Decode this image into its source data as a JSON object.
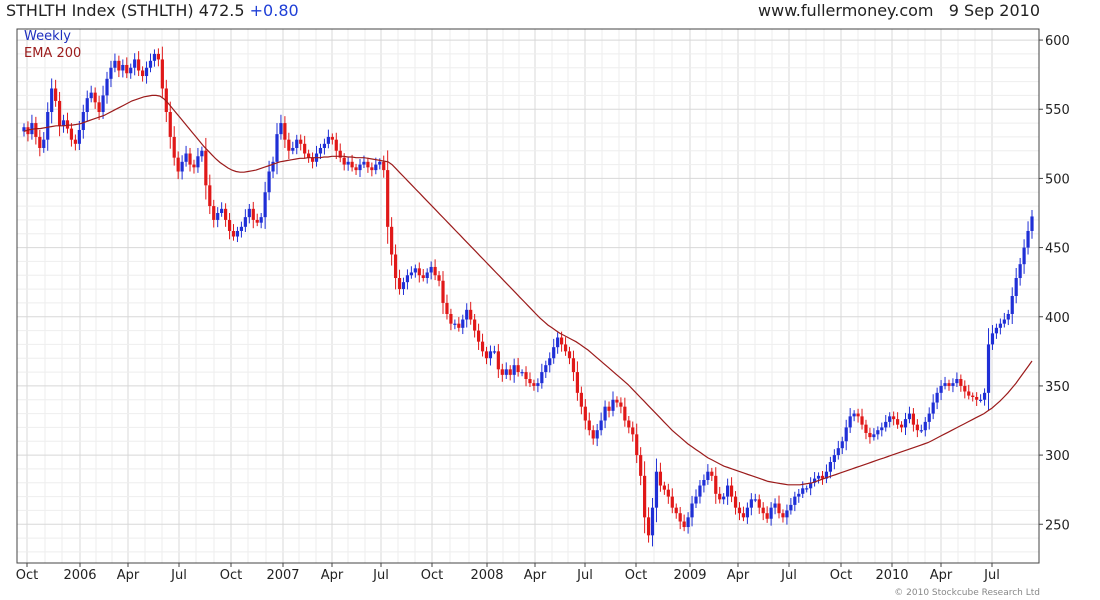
{
  "header": {
    "title": "STHLTH Index (STHLTH) 472.5",
    "change": "+0.80",
    "site": "www.fullermoney.com",
    "date": "9 Sep 2010"
  },
  "legend": {
    "weekly": "Weekly",
    "ema": "EMA 200"
  },
  "copyright": "© 2010 Stockcube Research Ltd",
  "colors": {
    "up": "#1f2fd6",
    "down": "#e01818",
    "ema": "#9b1b1b",
    "grid": "#d8d8d8",
    "frame": "#444444"
  },
  "chart_data": {
    "type": "candlestick",
    "interval": "weekly",
    "x_ticks": [
      "Oct",
      "2006",
      "Apr",
      "Jul",
      "Oct",
      "2007",
      "Apr",
      "Jul",
      "Oct",
      "2008",
      "Apr",
      "Jul",
      "Oct",
      "2009",
      "Apr",
      "Jul",
      "Oct",
      "2010",
      "Apr",
      "Jul"
    ],
    "y_ticks": [
      250,
      300,
      350,
      400,
      450,
      500,
      550,
      600
    ],
    "ylim": [
      222,
      608
    ],
    "y_axis_side": "right",
    "weekly_close": [
      537,
      532,
      540,
      530,
      522,
      528,
      548,
      565,
      556,
      538,
      542,
      536,
      528,
      525,
      535,
      548,
      558,
      562,
      555,
      548,
      560,
      572,
      580,
      585,
      578,
      582,
      576,
      580,
      586,
      578,
      574,
      580,
      585,
      590,
      586,
      565,
      548,
      530,
      515,
      505,
      512,
      518,
      510,
      508,
      516,
      520,
      495,
      480,
      470,
      475,
      478,
      470,
      462,
      458,
      462,
      465,
      472,
      478,
      470,
      468,
      472,
      490,
      505,
      512,
      532,
      540,
      528,
      520,
      522,
      528,
      525,
      518,
      515,
      512,
      518,
      522,
      525,
      530,
      528,
      520,
      515,
      510,
      512,
      508,
      506,
      510,
      512,
      508,
      506,
      510,
      512,
      506,
      465,
      445,
      428,
      420,
      425,
      430,
      432,
      435,
      430,
      428,
      432,
      436,
      430,
      426,
      410,
      402,
      395,
      395,
      392,
      398,
      405,
      398,
      390,
      382,
      375,
      370,
      375,
      375,
      362,
      358,
      362,
      358,
      365,
      360,
      360,
      355,
      352,
      350,
      352,
      360,
      365,
      370,
      378,
      385,
      380,
      375,
      370,
      360,
      345,
      335,
      325,
      318,
      312,
      318,
      325,
      335,
      332,
      340,
      338,
      335,
      325,
      320,
      315,
      300,
      285,
      255,
      242,
      262,
      288,
      278,
      275,
      270,
      262,
      258,
      252,
      248,
      255,
      265,
      270,
      278,
      282,
      288,
      285,
      272,
      268,
      270,
      278,
      270,
      262,
      258,
      255,
      262,
      268,
      268,
      262,
      258,
      254,
      262,
      265,
      258,
      255,
      260,
      264,
      270,
      272,
      276,
      276,
      280,
      283,
      285,
      283,
      288,
      295,
      300,
      305,
      310,
      320,
      328,
      330,
      328,
      322,
      316,
      313,
      315,
      318,
      320,
      324,
      328,
      326,
      322,
      320,
      326,
      330,
      322,
      318,
      318,
      324,
      330,
      338,
      345,
      350,
      352,
      350,
      352,
      355,
      350,
      346,
      343,
      342,
      340,
      340,
      345,
      380,
      388,
      392,
      395,
      398,
      402,
      415,
      428,
      438,
      450,
      462,
      472.5
    ],
    "ema_200": [
      534,
      535,
      535.5,
      536,
      536,
      536.5,
      537,
      537.5,
      538,
      538,
      538,
      538.5,
      538.5,
      539,
      539.5,
      540.5,
      541.5,
      542.5,
      543.5,
      544.5,
      545.5,
      547,
      548.5,
      550,
      551.5,
      553,
      554.5,
      556,
      557,
      558,
      559,
      559.5,
      560,
      560,
      559.5,
      557.5,
      554.5,
      551,
      547.5,
      544,
      540.5,
      537,
      533.5,
      530,
      526.5,
      523,
      520,
      517,
      514,
      511.5,
      509.5,
      507.5,
      506,
      505,
      504.5,
      504.5,
      505,
      505.5,
      506,
      507,
      508,
      509,
      510,
      511,
      512,
      512.5,
      513,
      513.5,
      514,
      514.5,
      514.5,
      515,
      515,
      515,
      515,
      515.5,
      515.5,
      516,
      516,
      516,
      516,
      515.5,
      515.5,
      515,
      515,
      515,
      514.5,
      514,
      513.5,
      513,
      512.5,
      512,
      510,
      507,
      504,
      501,
      498,
      495,
      492,
      489,
      486,
      483,
      480,
      477,
      474,
      471,
      468,
      465,
      462,
      459,
      456,
      453,
      450,
      447,
      444,
      441,
      438,
      435,
      432,
      429,
      426,
      423,
      420,
      417,
      414,
      411,
      408,
      405,
      402,
      399,
      396.5,
      394,
      392,
      390,
      388,
      386.5,
      385,
      383.5,
      382,
      380,
      378,
      376,
      373.5,
      371,
      368.5,
      366,
      363.5,
      361,
      358.5,
      356,
      353.5,
      351,
      348,
      345,
      342,
      339,
      336,
      333,
      330,
      327,
      324,
      321,
      318,
      315.5,
      313,
      310.5,
      308,
      306,
      304,
      302,
      300,
      298,
      296.5,
      295,
      293.5,
      292,
      291,
      290,
      289,
      288,
      287,
      286,
      285,
      284,
      283,
      282,
      281,
      280.5,
      280,
      279.5,
      279,
      278.5,
      278.5,
      278.5,
      278.5,
      279,
      279.5,
      280,
      281,
      282,
      283,
      284,
      285,
      286,
      287,
      288,
      289,
      290,
      291,
      292,
      293,
      294,
      295,
      296,
      297,
      298,
      299,
      300,
      301,
      302,
      303,
      304,
      305,
      306,
      307,
      308,
      309,
      310.5,
      312,
      313.5,
      315,
      316.5,
      318,
      319.5,
      321,
      322.5,
      324,
      325.5,
      327,
      328.5,
      330,
      332,
      334,
      336.5,
      339,
      342,
      345,
      348.5,
      352,
      356,
      360,
      364,
      368
    ]
  }
}
